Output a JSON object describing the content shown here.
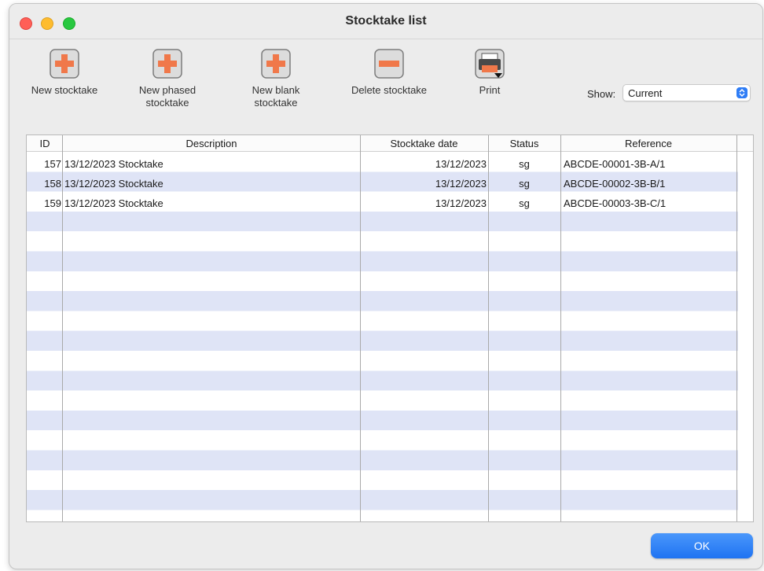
{
  "window": {
    "title": "Stocktake list"
  },
  "toolbar": {
    "new_stocktake": "New stocktake",
    "new_phased": "New phased\nstocktake",
    "new_blank": "New blank\nstocktake",
    "delete": "Delete stocktake",
    "print": "Print"
  },
  "filter": {
    "label": "Show:",
    "value": "Current"
  },
  "table": {
    "columns": [
      "ID",
      "Description",
      "Stocktake date",
      "Status",
      "Reference"
    ],
    "rows": [
      {
        "id": "157",
        "description": "13/12/2023 Stocktake",
        "date": "13/12/2023",
        "status": "sg",
        "reference": "ABCDE-00001-3B-A/1"
      },
      {
        "id": "158",
        "description": "13/12/2023 Stocktake",
        "date": "13/12/2023",
        "status": "sg",
        "reference": "ABCDE-00002-3B-B/1"
      },
      {
        "id": "159",
        "description": "13/12/2023 Stocktake",
        "date": "13/12/2023",
        "status": "sg",
        "reference": "ABCDE-00003-3B-C/1"
      }
    ]
  },
  "footer": {
    "ok_label": "OK"
  },
  "colors": {
    "accent": "#2f7df6",
    "tool_orange": "#f0784a",
    "stripe": "#dfe4f6"
  }
}
